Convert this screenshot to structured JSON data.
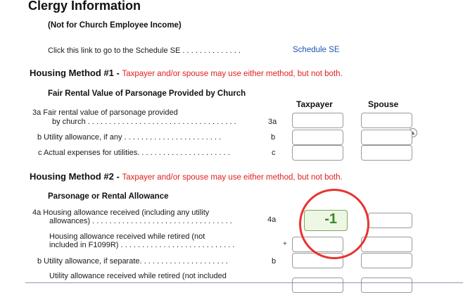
{
  "header": {
    "title": "Clergy Information",
    "note": "(Not for Church Employee Income)",
    "schedule_se_text": "Click this link to go to the Schedule SE . . . . . . . . . . . . . .",
    "schedule_se_link": "Schedule SE"
  },
  "method1": {
    "title": "Housing Method #1 - ",
    "note": "Taxpayer and/or spouse may use either method, but not both.",
    "section_title": "Fair Rental Value of Parsonage Provided by Church",
    "columns": {
      "taxpayer": "Taxpayer",
      "spouse": "Spouse"
    },
    "rows": [
      {
        "line1": "3a  Fair rental value of parsonage provided",
        "line2": "by church . . . . . . . . . . . . . . . . . . . . . . . . . . . . . . . . . . .",
        "code": "3a"
      },
      {
        "line1": "b  Utility allowance, if any . . . . . . . . . . . . . . . . . . . . . . .",
        "code": "b"
      },
      {
        "line1": "c  Actual expenses for utilities. . . . . . . . . . . . . . . . . . . . . .",
        "code": "c"
      }
    ]
  },
  "method2": {
    "title": "Housing Method #2 - ",
    "note": "Taxpayer and/or spouse may use either method, but not both.",
    "section_title": "Parsonage or Rental Allowance",
    "rows": [
      {
        "line1": "4a  Housing allowance received (including any utility",
        "line2": "allowances) . . . . . . . . . . . . . . . . . . . . . . . . . . . . . . . . .",
        "code": "4a",
        "taxpayer_value": "-1"
      },
      {
        "line1": "Housing allowance received while retired (not",
        "line2": "included in F1099R) . . . . . . . . . . . . . . . . . . . . . . . . . . .",
        "code": "+"
      },
      {
        "line1": "b  Utility allowance, if separate. . . . . . . . . . . . . . . . . . . . .",
        "code": "b"
      },
      {
        "line1": "Utility allowance received while retired (not included"
      }
    ]
  },
  "colors": {
    "accent_red": "#e02020",
    "link_blue": "#1f56b0",
    "highlight_circle": "#e8332f"
  },
  "icons": {
    "scroll": "scroll-up-icon"
  }
}
